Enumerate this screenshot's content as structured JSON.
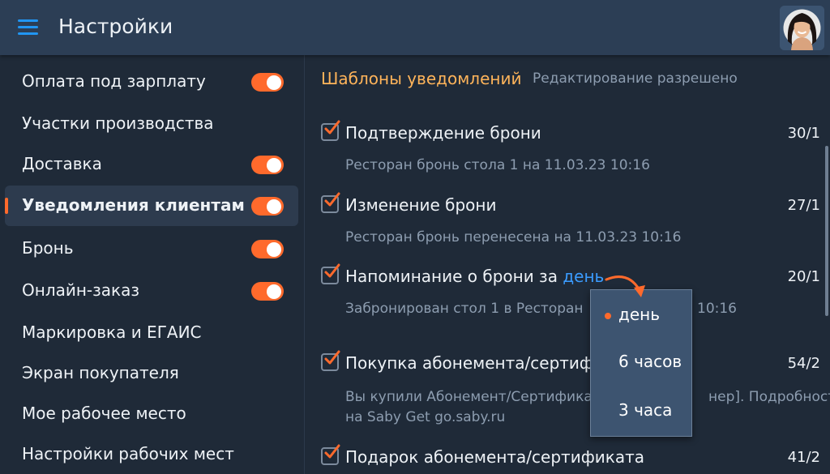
{
  "header": {
    "title": "Настройки",
    "avatar_icon": "user-avatar"
  },
  "colors": {
    "accent": "#ff6a2c",
    "link": "#3b9cff",
    "section_title": "#ffb45a",
    "header_bg": "#2c3e55",
    "bg": "#1f2a38"
  },
  "sidebar": {
    "items": [
      {
        "label": "Оплата под зарплату",
        "toggle": true
      },
      {
        "label": "Участки производства",
        "toggle": false
      },
      {
        "label": "Доставка",
        "toggle": true
      },
      {
        "label": "Уведомления клиентам",
        "toggle": true,
        "active": true
      },
      {
        "label": "Бронь",
        "toggle": true
      },
      {
        "label": "Онлайн-заказ",
        "toggle": true
      },
      {
        "label": "Маркировка и ЕГАИС",
        "toggle": false
      },
      {
        "label": "Экран покупателя",
        "toggle": false
      },
      {
        "label": "Мое рабочее место",
        "toggle": false
      },
      {
        "label": "Настройки рабочих мест",
        "toggle": false
      }
    ]
  },
  "main": {
    "section_title": "Шаблоны уведомлений",
    "section_subtitle": "Редактирование разрешено",
    "templates": [
      {
        "title": "Подтверждение брони",
        "count": "30/1",
        "desc": "Ресторан бронь стола 1 на 11.03.23 10:16",
        "checked": true
      },
      {
        "title": "Изменение брони",
        "count": "27/1",
        "desc": "Ресторан бронь перенесена на 11.03.23 10:16",
        "checked": true
      },
      {
        "title_prefix": "Напоминание о брони за",
        "title_link": "день",
        "count": "20/1",
        "desc_left": "Забронирован стол 1 в Ресторан",
        "desc_right": "10:16",
        "checked": true
      },
      {
        "title": "Покупка абонемента/сертиф",
        "count": "54/2",
        "desc_line1_left": "Вы купили Абонемент/Сертифика",
        "desc_line1_right": "нер]. Подробности",
        "desc_line2": "на Saby Get go.saby.ru",
        "checked": true
      },
      {
        "title": "Подарок абонемента/сертификата",
        "count": "41/2",
        "checked": true
      }
    ]
  },
  "dropdown": {
    "selected": "день",
    "options": [
      "день",
      "6 часов",
      "3 часа"
    ]
  }
}
